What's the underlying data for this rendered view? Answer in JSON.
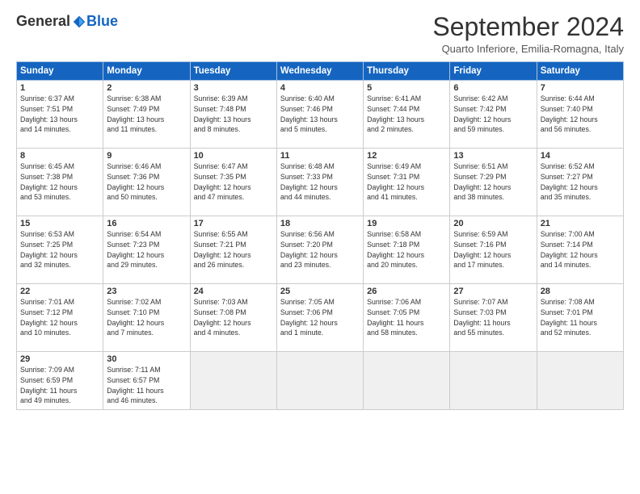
{
  "logo": {
    "general": "General",
    "blue": "Blue"
  },
  "header": {
    "month": "September 2024",
    "location": "Quarto Inferiore, Emilia-Romagna, Italy"
  },
  "weekdays": [
    "Sunday",
    "Monday",
    "Tuesday",
    "Wednesday",
    "Thursday",
    "Friday",
    "Saturday"
  ],
  "days": [
    {
      "num": "",
      "info": ""
    },
    {
      "num": "",
      "info": ""
    },
    {
      "num": "",
      "info": ""
    },
    {
      "num": "",
      "info": ""
    },
    {
      "num": "",
      "info": ""
    },
    {
      "num": "",
      "info": ""
    },
    {
      "num": "7",
      "info": "Sunrise: 6:44 AM\nSunset: 7:40 PM\nDaylight: 12 hours\nand 56 minutes."
    },
    {
      "num": "1",
      "info": "Sunrise: 6:37 AM\nSunset: 7:51 PM\nDaylight: 13 hours\nand 14 minutes."
    },
    {
      "num": "2",
      "info": "Sunrise: 6:38 AM\nSunset: 7:49 PM\nDaylight: 13 hours\nand 11 minutes."
    },
    {
      "num": "3",
      "info": "Sunrise: 6:39 AM\nSunset: 7:48 PM\nDaylight: 13 hours\nand 8 minutes."
    },
    {
      "num": "4",
      "info": "Sunrise: 6:40 AM\nSunset: 7:46 PM\nDaylight: 13 hours\nand 5 minutes."
    },
    {
      "num": "5",
      "info": "Sunrise: 6:41 AM\nSunset: 7:44 PM\nDaylight: 13 hours\nand 2 minutes."
    },
    {
      "num": "6",
      "info": "Sunrise: 6:42 AM\nSunset: 7:42 PM\nDaylight: 12 hours\nand 59 minutes."
    },
    {
      "num": "7",
      "info": "Sunrise: 6:44 AM\nSunset: 7:40 PM\nDaylight: 12 hours\nand 56 minutes."
    },
    {
      "num": "8",
      "info": "Sunrise: 6:45 AM\nSunset: 7:38 PM\nDaylight: 12 hours\nand 53 minutes."
    },
    {
      "num": "9",
      "info": "Sunrise: 6:46 AM\nSunset: 7:36 PM\nDaylight: 12 hours\nand 50 minutes."
    },
    {
      "num": "10",
      "info": "Sunrise: 6:47 AM\nSunset: 7:35 PM\nDaylight: 12 hours\nand 47 minutes."
    },
    {
      "num": "11",
      "info": "Sunrise: 6:48 AM\nSunset: 7:33 PM\nDaylight: 12 hours\nand 44 minutes."
    },
    {
      "num": "12",
      "info": "Sunrise: 6:49 AM\nSunset: 7:31 PM\nDaylight: 12 hours\nand 41 minutes."
    },
    {
      "num": "13",
      "info": "Sunrise: 6:51 AM\nSunset: 7:29 PM\nDaylight: 12 hours\nand 38 minutes."
    },
    {
      "num": "14",
      "info": "Sunrise: 6:52 AM\nSunset: 7:27 PM\nDaylight: 12 hours\nand 35 minutes."
    },
    {
      "num": "15",
      "info": "Sunrise: 6:53 AM\nSunset: 7:25 PM\nDaylight: 12 hours\nand 32 minutes."
    },
    {
      "num": "16",
      "info": "Sunrise: 6:54 AM\nSunset: 7:23 PM\nDaylight: 12 hours\nand 29 minutes."
    },
    {
      "num": "17",
      "info": "Sunrise: 6:55 AM\nSunset: 7:21 PM\nDaylight: 12 hours\nand 26 minutes."
    },
    {
      "num": "18",
      "info": "Sunrise: 6:56 AM\nSunset: 7:20 PM\nDaylight: 12 hours\nand 23 minutes."
    },
    {
      "num": "19",
      "info": "Sunrise: 6:58 AM\nSunset: 7:18 PM\nDaylight: 12 hours\nand 20 minutes."
    },
    {
      "num": "20",
      "info": "Sunrise: 6:59 AM\nSunset: 7:16 PM\nDaylight: 12 hours\nand 17 minutes."
    },
    {
      "num": "21",
      "info": "Sunrise: 7:00 AM\nSunset: 7:14 PM\nDaylight: 12 hours\nand 14 minutes."
    },
    {
      "num": "22",
      "info": "Sunrise: 7:01 AM\nSunset: 7:12 PM\nDaylight: 12 hours\nand 10 minutes."
    },
    {
      "num": "23",
      "info": "Sunrise: 7:02 AM\nSunset: 7:10 PM\nDaylight: 12 hours\nand 7 minutes."
    },
    {
      "num": "24",
      "info": "Sunrise: 7:03 AM\nSunset: 7:08 PM\nDaylight: 12 hours\nand 4 minutes."
    },
    {
      "num": "25",
      "info": "Sunrise: 7:05 AM\nSunset: 7:06 PM\nDaylight: 12 hours\nand 1 minute."
    },
    {
      "num": "26",
      "info": "Sunrise: 7:06 AM\nSunset: 7:05 PM\nDaylight: 11 hours\nand 58 minutes."
    },
    {
      "num": "27",
      "info": "Sunrise: 7:07 AM\nSunset: 7:03 PM\nDaylight: 11 hours\nand 55 minutes."
    },
    {
      "num": "28",
      "info": "Sunrise: 7:08 AM\nSunset: 7:01 PM\nDaylight: 11 hours\nand 52 minutes."
    },
    {
      "num": "29",
      "info": "Sunrise: 7:09 AM\nSunset: 6:59 PM\nDaylight: 11 hours\nand 49 minutes."
    },
    {
      "num": "30",
      "info": "Sunrise: 7:11 AM\nSunset: 6:57 PM\nDaylight: 11 hours\nand 46 minutes."
    },
    {
      "num": "",
      "info": ""
    },
    {
      "num": "",
      "info": ""
    },
    {
      "num": "",
      "info": ""
    },
    {
      "num": "",
      "info": ""
    },
    {
      "num": "",
      "info": ""
    }
  ]
}
